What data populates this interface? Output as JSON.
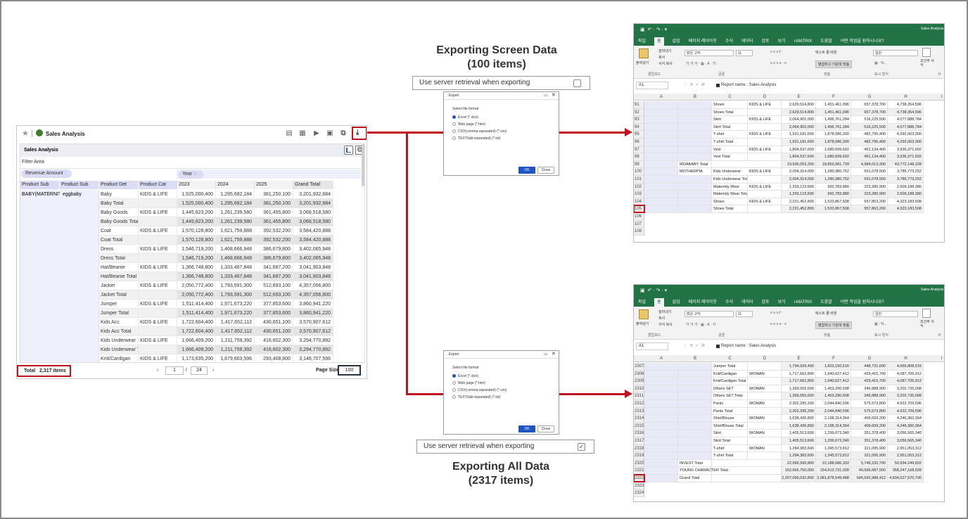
{
  "report": {
    "title": "Sales Analysis",
    "panel_title": "Sales Analysis",
    "filter_area": "Filter Area",
    "chip_revenue": "Revenue Amount",
    "chip_year": "Year",
    "row_headers": [
      "Product Sub",
      "Product Sub",
      "Product Det",
      "Product Cat"
    ],
    "year_headers": [
      "2023",
      "2024",
      "2025",
      "Grand Total"
    ],
    "row_group_1": "BABY(MATERNITY",
    "row_group_2": "eggbaby",
    "rows": [
      {
        "name": "Baby",
        "cat": "KIDS & LIFE",
        "v": [
          "1,525,000,400",
          "1,295,682,184",
          "381,250,100",
          "3,201,932,684"
        ],
        "total": false
      },
      {
        "name": "Baby Total",
        "cat": "",
        "v": [
          "1,525,000,400",
          "1,295,682,184",
          "381,250,100",
          "3,201,932,684"
        ],
        "total": true
      },
      {
        "name": "Baby Goods",
        "cat": "KIDS & LIFE",
        "v": [
          "1,445,823,200",
          "1,261,239,580",
          "361,455,800",
          "3,068,518,580"
        ],
        "total": false
      },
      {
        "name": "Baby Goods Total",
        "cat": "",
        "v": [
          "1,445,823,200",
          "1,261,239,580",
          "361,455,800",
          "3,068,518,580"
        ],
        "total": true
      },
      {
        "name": "Coat",
        "cat": "KIDS & LIFE",
        "v": [
          "1,570,128,800",
          "1,621,759,888",
          "392,532,200",
          "3,584,420,888"
        ],
        "total": false
      },
      {
        "name": "Coat Total",
        "cat": "",
        "v": [
          "1,570,128,800",
          "1,621,759,888",
          "392,532,200",
          "3,584,420,888"
        ],
        "total": true
      },
      {
        "name": "Dress",
        "cat": "KIDS & LIFE",
        "v": [
          "1,546,719,200",
          "1,468,666,948",
          "386,679,800",
          "3,402,065,948"
        ],
        "total": false
      },
      {
        "name": "Dress Total",
        "cat": "",
        "v": [
          "1,546,719,200",
          "1,468,666,948",
          "386,679,800",
          "3,402,065,948"
        ],
        "total": true
      },
      {
        "name": "Hat/Beanie",
        "cat": "KIDS & LIFE",
        "v": [
          "1,366,748,800",
          "1,333,467,848",
          "341,687,200",
          "3,041,903,848"
        ],
        "total": false
      },
      {
        "name": "Hat/Beanie Total",
        "cat": "",
        "v": [
          "1,366,748,800",
          "1,333,467,848",
          "341,687,200",
          "3,041,903,848"
        ],
        "total": true
      },
      {
        "name": "Jacket",
        "cat": "KIDS & LIFE",
        "v": [
          "2,050,772,400",
          "1,793,591,300",
          "512,693,100",
          "4,357,056,800"
        ],
        "total": false
      },
      {
        "name": "Jacket Total",
        "cat": "",
        "v": [
          "2,050,772,400",
          "1,793,591,300",
          "512,693,100",
          "4,357,056,800"
        ],
        "total": true
      },
      {
        "name": "Jumper",
        "cat": "KIDS & LIFE",
        "v": [
          "1,511,414,400",
          "1,971,673,220",
          "377,853,600",
          "3,860,941,220"
        ],
        "total": false
      },
      {
        "name": "Jumper Total",
        "cat": "",
        "v": [
          "1,511,414,400",
          "1,971,673,220",
          "377,853,600",
          "3,860,941,220"
        ],
        "total": true
      },
      {
        "name": "Kids Acc",
        "cat": "KIDS & LIFE",
        "v": [
          "1,722,604,400",
          "1,417,652,112",
          "430,651,100",
          "3,570,907,612"
        ],
        "total": false
      },
      {
        "name": "Kids Acc Total",
        "cat": "",
        "v": [
          "1,722,604,400",
          "1,417,652,112",
          "430,651,100",
          "3,570,907,612"
        ],
        "total": true
      },
      {
        "name": "Kids Underwear",
        "cat": "KIDS & LIFE",
        "v": [
          "1,666,409,200",
          "1,211,759,392",
          "416,602,300",
          "3,294,770,892"
        ],
        "total": false
      },
      {
        "name": "Kids Underwear Total",
        "cat": "",
        "v": [
          "1,666,409,200",
          "1,211,759,392",
          "416,602,300",
          "3,294,770,892"
        ],
        "total": true
      },
      {
        "name": "Knit/Cardigan",
        "cat": "KIDS & LIFE",
        "v": [
          "1,173,635,200",
          "1,679,663,596",
          "293,408,800",
          "3,146,707,596"
        ],
        "total": false
      }
    ],
    "total_label": "Total",
    "total_count": "2,317 items",
    "page_current": "1",
    "page_sep": "/",
    "page_total": "24",
    "page_size_label": "Page Size",
    "page_size": "100"
  },
  "captions": {
    "screen_line1": "Exporting Screen Data",
    "screen_line2": "(100 items)",
    "all_line1": "Exporting All Data",
    "all_line2": "(2317 items)"
  },
  "server_option": {
    "label": "Use server retrieval when exporting",
    "top_checked": false,
    "bottom_checked": true,
    "check_mark": "✓"
  },
  "dialog": {
    "title": "Export",
    "prompt": "Select file format",
    "options": [
      "Excel (*.xlsx)",
      "Web page (*.htm)",
      "CSV(comma-separated) (*.csv)",
      "TEXT(tab-separated) (*.txt)"
    ],
    "ok": "OK",
    "close": "Close"
  },
  "excel": {
    "app_title": "Sales Analysis",
    "tabs": [
      "파일",
      "홈",
      "삽입",
      "페이지 레이아웃",
      "수식",
      "데이터",
      "검토",
      "보기",
      "i-MATRIX",
      "도움말",
      "어떤 작업을 원하시나요?"
    ],
    "clipboard": {
      "paste": "붙여넣기",
      "cut": "잘라내기",
      "copy": "복사",
      "format_painter": "서식 복사",
      "group": "클립보드"
    },
    "font": {
      "name": "맑은 고딕",
      "size": "11",
      "group": "글꼴"
    },
    "alignment": {
      "wrap": "텍스트 줄 바꿈",
      "merge": "병합하고 가운데 맞춤",
      "group": "맞춤"
    },
    "number": {
      "format": "일반",
      "group": "표시 형식"
    },
    "styles": {
      "conditional": "조건부 서식",
      "group": "서"
    },
    "name_box": "A1",
    "formula": "Report name : Sales Analysis",
    "columns": [
      "A",
      "B",
      "C",
      "D",
      "E",
      "F",
      "G",
      "H",
      "I"
    ],
    "top_rows": [
      {
        "n": "91",
        "b": "",
        "c": "Shoes",
        "d": "KIDS & LIFE",
        "v": [
          "2,629,514,800",
          "1,451,461,096",
          "657,378,700",
          "4,738,354,596"
        ]
      },
      {
        "n": "92",
        "b": "",
        "c": "Shoes Total",
        "d": "",
        "v": [
          "2,629,514,800",
          "1,451,461,096",
          "657,378,700",
          "4,738,354,596"
        ]
      },
      {
        "n": "93",
        "b": "",
        "c": "Skirt",
        "d": "KIDS & LIFE",
        "v": [
          "2,064,902,000",
          "1,496,761,284",
          "516,225,500",
          "4,077,888,784"
        ]
      },
      {
        "n": "94",
        "b": "",
        "c": "Skirt Total",
        "d": "",
        "v": [
          "2,064,902,000",
          "1,496,761,284",
          "516,225,500",
          "4,077,888,784"
        ]
      },
      {
        "n": "95",
        "b": "",
        "c": "T-shirt",
        "d": "KIDS & LIFE",
        "v": [
          "1,931,181,600",
          "1,878,086,300",
          "482,795,400",
          "4,292,063,300"
        ]
      },
      {
        "n": "96",
        "b": "",
        "c": "T-shirt Total",
        "d": "",
        "v": [
          "1,931,181,600",
          "1,878,086,300",
          "482,795,400",
          "4,292,063,300"
        ]
      },
      {
        "n": "97",
        "b": "",
        "c": "Vest",
        "d": "KIDS & LIFE",
        "v": [
          "1,804,537,600",
          "1,680,699,692",
          "451,134,400",
          "3,936,371,692"
        ]
      },
      {
        "n": "98",
        "b": "",
        "c": "Vest Total",
        "d": "",
        "v": [
          "1,804,537,600",
          "1,680,699,692",
          "451,134,400",
          "3,936,371,692"
        ]
      },
      {
        "n": "99",
        "b": "MOABABY Total",
        "c": "",
        "d": "",
        "v": [
          "19,936,053,200",
          "18,852,081,728",
          "4,984,013,300",
          "43,772,148,228"
        ]
      },
      {
        "n": "100",
        "b": "MOTHERPIA",
        "c": "Kids Underwear",
        "d": "KIDS & LIFE",
        "v": [
          "2,004,314,000",
          "1,280,380,752",
          "501,078,500",
          "3,785,773,252"
        ]
      },
      {
        "n": "101",
        "b": "",
        "c": "Kids Underwear Total",
        "d": "",
        "v": [
          "2,004,314,000",
          "1,280,380,752",
          "501,078,500",
          "3,785,773,252"
        ]
      },
      {
        "n": "102",
        "b": "",
        "c": "Maternity Wear",
        "d": "KIDS & LIFE",
        "v": [
          "1,293,123,600",
          "992,783,880",
          "323,280,900",
          "2,609,188,380"
        ]
      },
      {
        "n": "103",
        "b": "",
        "c": "Maternity Wear Total",
        "d": "",
        "v": [
          "1,293,123,600",
          "992,783,880",
          "323,280,900",
          "2,609,188,380"
        ]
      },
      {
        "n": "104",
        "b": "",
        "c": "Shoes",
        "d": "KIDS & LIFE",
        "v": [
          "2,231,452,800",
          "1,533,867,508",
          "557,863,200",
          "4,323,183,508"
        ]
      },
      {
        "n": "105",
        "b": "",
        "c": "Shoes Total",
        "d": "",
        "v": [
          "2,231,452,800",
          "1,533,867,508",
          "557,863,200",
          "4,323,183,508"
        ]
      },
      {
        "n": "106",
        "b": "",
        "c": "",
        "d": "",
        "v": [
          "",
          "",
          "",
          ""
        ]
      },
      {
        "n": "107",
        "b": "",
        "c": "",
        "d": "",
        "v": [
          "",
          "",
          "",
          ""
        ]
      },
      {
        "n": "108",
        "b": "",
        "c": "",
        "d": "",
        "v": [
          "",
          "",
          "",
          ""
        ]
      }
    ],
    "top_highlight_row": "105",
    "bottom_rows": [
      {
        "n": "2307",
        "b": "",
        "c": "Jumper Total",
        "d": "",
        "v": [
          "1,794,926,400",
          "1,823,150,516",
          "448,731,600",
          "4,066,808,516"
        ]
      },
      {
        "n": "2308",
        "b": "",
        "c": "Knit/Cardigan",
        "d": "WOMAN",
        "v": [
          "1,717,662,800",
          "1,940,627,412",
          "429,415,700",
          "4,087,705,912"
        ]
      },
      {
        "n": "2309",
        "b": "",
        "c": "Knit/Cardigan Total",
        "d": "",
        "v": [
          "1,717,662,800",
          "1,940,627,412",
          "429,415,700",
          "4,087,705,912"
        ]
      },
      {
        "n": "2310",
        "b": "",
        "c": "Others SET",
        "d": "WOMAN",
        "v": [
          "1,399,555,600",
          "1,453,290,508",
          "349,888,900",
          "3,202,735,008"
        ]
      },
      {
        "n": "2311",
        "b": "",
        "c": "Others SET Total",
        "d": "",
        "v": [
          "1,399,555,600",
          "1,453,290,508",
          "349,888,900",
          "3,202,735,008"
        ]
      },
      {
        "n": "2312",
        "b": "",
        "c": "Pants",
        "d": "WOMAN",
        "v": [
          "2,302,295,200",
          "2,044,840,596",
          "575,573,800",
          "4,922,709,596"
        ]
      },
      {
        "n": "2313",
        "b": "",
        "c": "Pants Total",
        "d": "",
        "v": [
          "2,302,295,200",
          "2,044,840,596",
          "575,573,800",
          "4,922,709,596"
        ]
      },
      {
        "n": "2314",
        "b": "",
        "c": "Shirt/Blouse",
        "d": "WOMAN",
        "v": [
          "1,638,436,800",
          "2,198,314,364",
          "409,609,200",
          "4,246,360,364"
        ]
      },
      {
        "n": "2315",
        "b": "",
        "c": "Shirt/Blouse Total",
        "d": "",
        "v": [
          "1,638,436,800",
          "2,198,314,364",
          "409,609,200",
          "4,246,360,364"
        ]
      },
      {
        "n": "2316",
        "b": "",
        "c": "Skirt",
        "d": "WOMAN",
        "v": [
          "1,405,513,600",
          "1,299,673,340",
          "351,378,400",
          "3,056,565,340"
        ]
      },
      {
        "n": "2317",
        "b": "",
        "c": "Skirt Total",
        "d": "",
        "v": [
          "1,405,513,600",
          "1,299,673,340",
          "351,378,400",
          "3,056,565,340"
        ]
      },
      {
        "n": "2318",
        "b": "",
        "c": "T-shirt",
        "d": "WOMAN",
        "v": [
          "1,284,383,600",
          "1,345,573,812",
          "321,095,900",
          "2,951,053,312"
        ]
      },
      {
        "n": "2319",
        "b": "",
        "c": "T-shirt Total",
        "d": "",
        "v": [
          "1,284,383,600",
          "1,345,573,812",
          "321,095,900",
          "2,951,053,312"
        ]
      },
      {
        "n": "2320",
        "b": "INVEST Total",
        "c": "",
        "d": "",
        "v": [
          "22,996,930,800",
          "22,188,086,332",
          "5,749,232,700",
          "50,934,249,832"
        ]
      },
      {
        "n": "2321",
        "b": "YOUNG CHARACTER Total",
        "c": "",
        "d": "",
        "v": [
          "162,666,750,000",
          "154,913,731,028",
          "40,666,687,500",
          "358,247,168,528"
        ]
      },
      {
        "n": "2322",
        "b": "Grand Total",
        "c": "",
        "d": "",
        "v": [
          "2,207,056,032,800",
          "2,081,878,549,488",
          "545,592,988,412",
          "4,834,527,570,700"
        ]
      },
      {
        "n": "2323",
        "b": "",
        "c": "",
        "d": "",
        "v": [
          "",
          "",
          "",
          ""
        ]
      },
      {
        "n": "2324",
        "b": "",
        "c": "",
        "d": "",
        "v": [
          "",
          "",
          "",
          ""
        ]
      }
    ],
    "bottom_highlight_row": "2322"
  },
  "colors": {
    "highlight": "#c1121f",
    "excel_green": "#217346",
    "ok_blue": "#1f54c5",
    "header_lavender": "#dcdcf7"
  }
}
